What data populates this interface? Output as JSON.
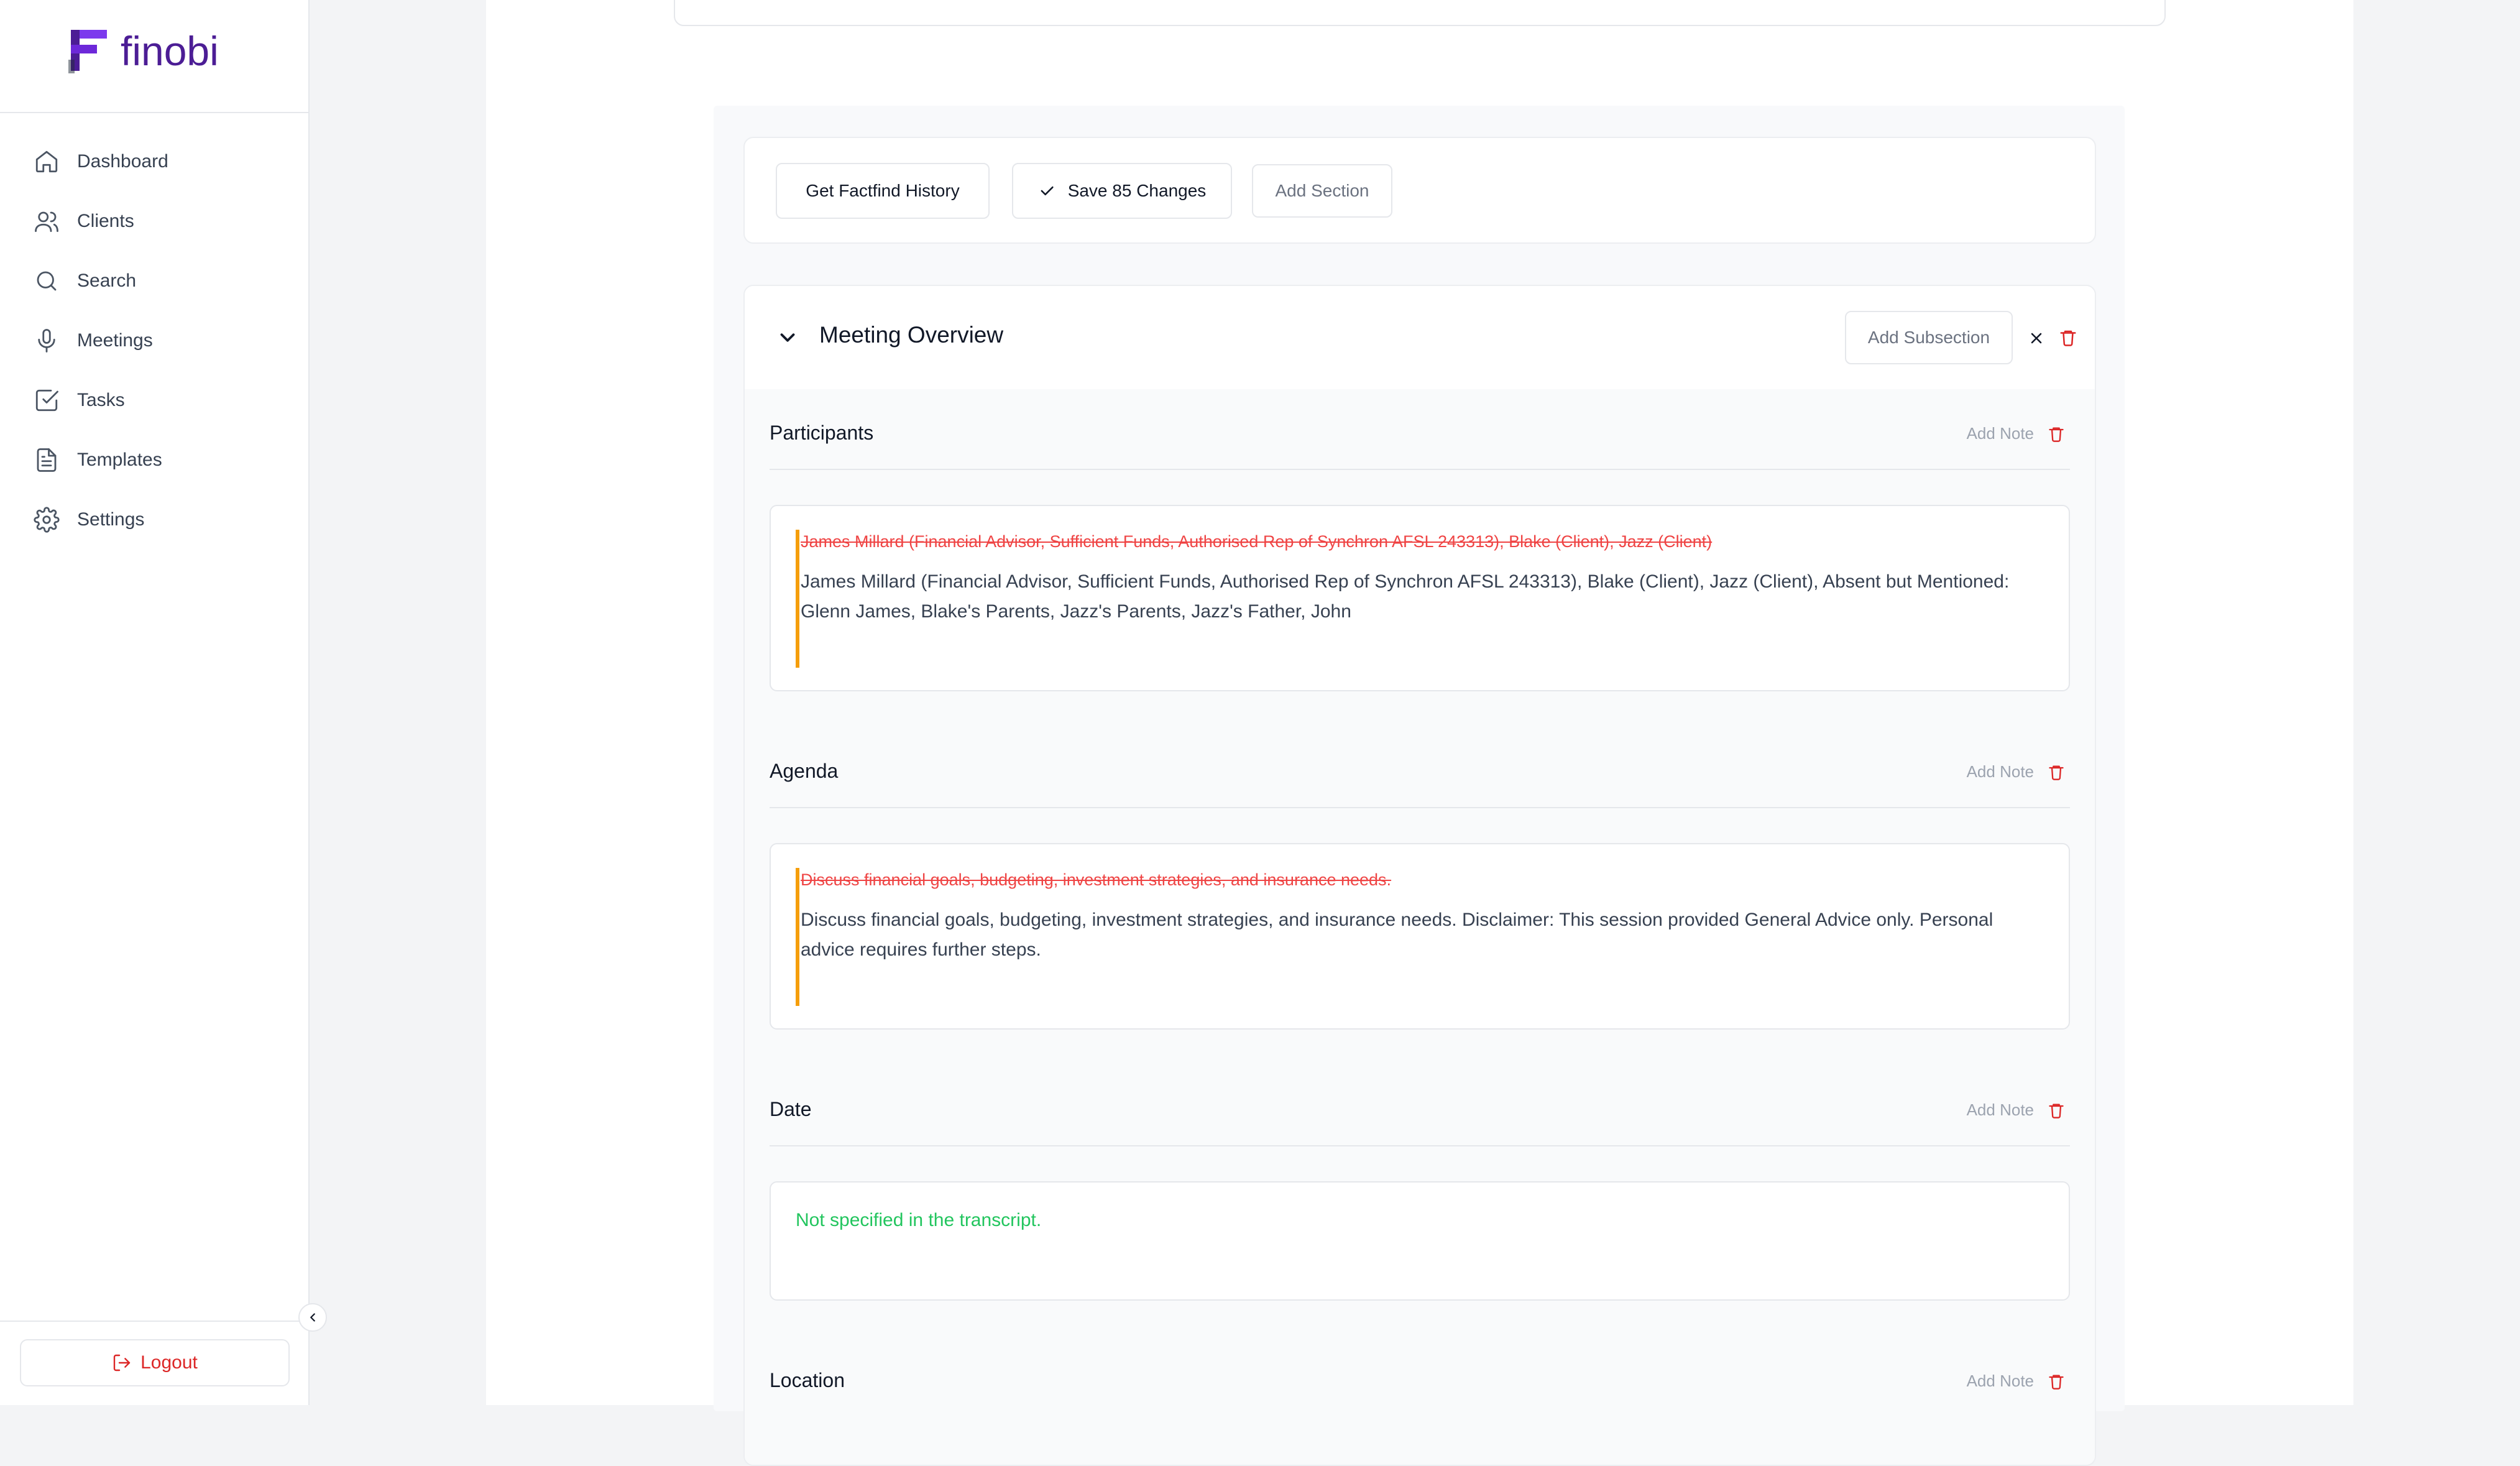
{
  "brand": {
    "name": "finobi"
  },
  "sidebar": {
    "items": [
      {
        "label": "Dashboard",
        "icon": "home-icon"
      },
      {
        "label": "Clients",
        "icon": "users-icon"
      },
      {
        "label": "Search",
        "icon": "search-icon"
      },
      {
        "label": "Meetings",
        "icon": "microphone-icon"
      },
      {
        "label": "Tasks",
        "icon": "check-square-icon"
      },
      {
        "label": "Templates",
        "icon": "file-text-icon"
      },
      {
        "label": "Settings",
        "icon": "gear-icon"
      }
    ],
    "logout_label": "Logout"
  },
  "toolbar": {
    "history_label": "Get Factfind History",
    "save_label": "Save 85 Changes",
    "add_section_label": "Add Section"
  },
  "section": {
    "title": "Meeting Overview",
    "add_subsection_label": "Add Subsection",
    "subsections": [
      {
        "title": "Participants",
        "add_note_label": "Add Note",
        "old_text": "James Millard (Financial Advisor, Sufficient Funds, Authorised Rep of Synchron AFSL 243313), Blake (Client), Jazz (Client)",
        "new_text": "James Millard (Financial Advisor, Sufficient Funds, Authorised Rep of Synchron AFSL 243313), Blake (Client), Jazz (Client), Absent but Mentioned: Glenn James, Blake's Parents, Jazz's Parents, Jazz's Father, John"
      },
      {
        "title": "Agenda",
        "add_note_label": "Add Note",
        "old_text": "Discuss financial goals, budgeting, investment strategies, and insurance needs.",
        "new_text": "Discuss financial goals, budgeting, investment strategies, and insurance needs. Disclaimer: This session provided General Advice only. Personal advice requires further steps."
      },
      {
        "title": "Date",
        "add_note_label": "Add Note",
        "value_text": "Not specified in the transcript."
      },
      {
        "title": "Location",
        "add_note_label": "Add Note"
      }
    ]
  },
  "colors": {
    "brand": "#4c1d95",
    "danger": "#dc2626",
    "change_bar": "#f59e0b",
    "new_value": "#22c55e"
  }
}
